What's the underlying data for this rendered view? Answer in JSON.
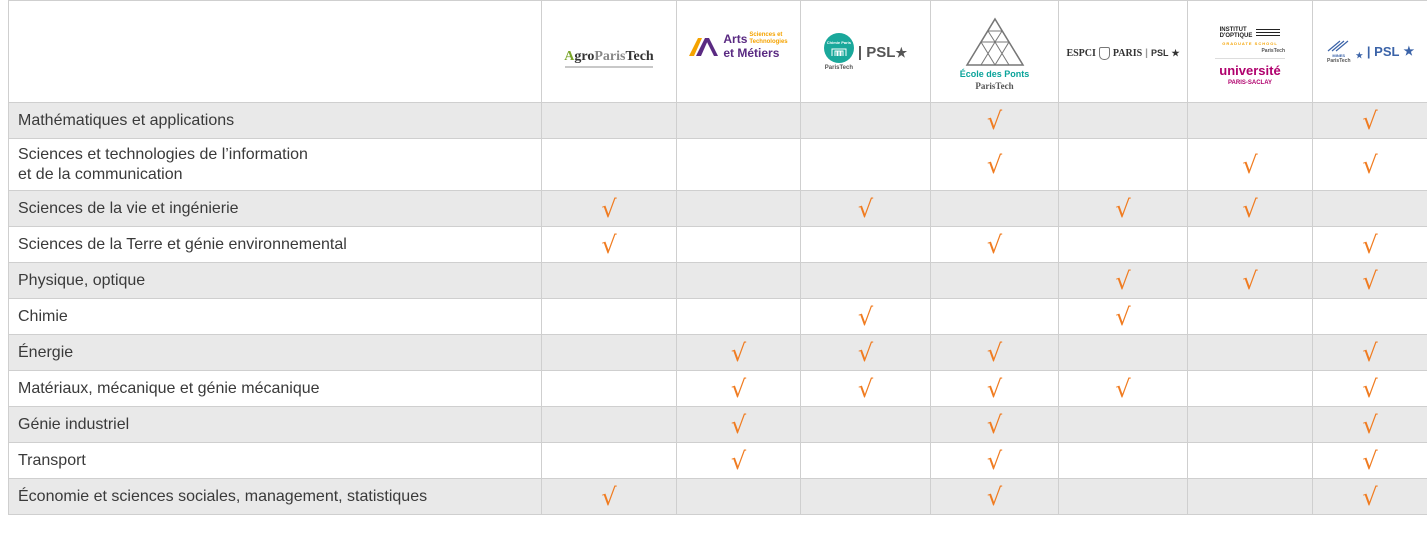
{
  "header": {
    "agro": {
      "prefix": "A",
      "mid": "gro",
      "paris": "Paris",
      "tech": "Tech"
    },
    "am": {
      "line1": "Arts",
      "line2": "et Métiers",
      "sub1": "Sciences et",
      "sub2": "Technologies"
    },
    "chimie": {
      "top": "Chimie Paris",
      "bottom": "ParisTech",
      "sep": "| ",
      "psl": "PSL",
      "star": "★"
    },
    "ponts": {
      "name": "École des Ponts",
      "sub": "ParisTech"
    },
    "espci": {
      "text": "ESPCI",
      "paris": "PARIS",
      "psl": "PSL",
      "star": "★"
    },
    "iogs": {
      "inst": "INSTITUT",
      "opt": "D'OPTIQUE",
      "gs": "GRADUATE SCHOOL",
      "pt": "ParisTech",
      "univ": "université",
      "ps": "PARIS-SACLAY"
    },
    "mines": {
      "mines": "MINES",
      "pt": "ParisTech",
      "psl": "| PSL",
      "star": "★"
    }
  },
  "check": "√",
  "rows": [
    {
      "label": [
        "Mathématiques et applications"
      ],
      "marks": [
        false,
        false,
        false,
        true,
        false,
        false,
        true
      ]
    },
    {
      "label": [
        "Sciences et technologies de l’information",
        "et de la communication"
      ],
      "marks": [
        false,
        false,
        false,
        true,
        false,
        true,
        true
      ]
    },
    {
      "label": [
        "Sciences de la vie et ingénierie"
      ],
      "marks": [
        true,
        false,
        true,
        false,
        true,
        true,
        false
      ]
    },
    {
      "label": [
        "Sciences de la Terre et génie environnemental"
      ],
      "marks": [
        true,
        false,
        false,
        true,
        false,
        false,
        true
      ]
    },
    {
      "label": [
        "Physique, optique"
      ],
      "marks": [
        false,
        false,
        false,
        false,
        true,
        true,
        true
      ]
    },
    {
      "label": [
        "Chimie"
      ],
      "marks": [
        false,
        false,
        true,
        false,
        true,
        false,
        false
      ]
    },
    {
      "label": [
        "Énergie"
      ],
      "marks": [
        false,
        true,
        true,
        true,
        false,
        false,
        true
      ]
    },
    {
      "label": [
        "Matériaux, mécanique et génie mécanique"
      ],
      "marks": [
        false,
        true,
        true,
        true,
        true,
        false,
        true
      ]
    },
    {
      "label": [
        "Génie industriel"
      ],
      "marks": [
        false,
        true,
        false,
        true,
        false,
        false,
        true
      ]
    },
    {
      "label": [
        "Transport"
      ],
      "marks": [
        false,
        true,
        false,
        true,
        false,
        false,
        true
      ]
    },
    {
      "label": [
        "Économie et sciences sociales, management, statistiques"
      ],
      "marks": [
        true,
        false,
        false,
        true,
        false,
        false,
        true
      ]
    }
  ],
  "colors": {
    "check": "#f07c21",
    "shade": "#e9e9e9",
    "am_purple": "#5a2a82",
    "am_orange": "#f5a300",
    "chimie_teal": "#1aa89b",
    "ponts_teal": "#0aa39a",
    "iogs_pink": "#b0006d"
  }
}
